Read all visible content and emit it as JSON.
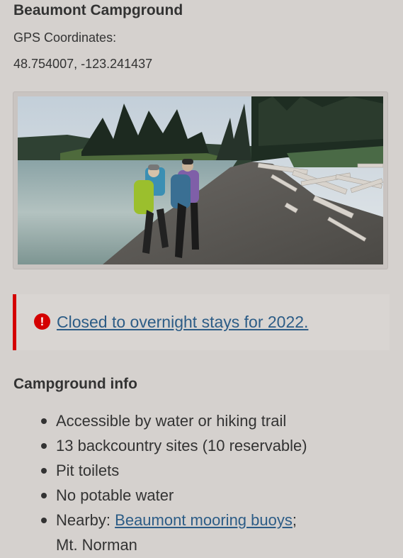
{
  "header": {
    "title": "Beaumont Campground",
    "gps_label": "GPS Coordinates:",
    "gps_value": "48.754007, -123.241437"
  },
  "photo": {
    "subject": "hikers-on-beach-photo"
  },
  "alert": {
    "icon": "exclamation-circle-icon",
    "text": "Closed to overnight stays for 2022.",
    "accent_color": "#d40000",
    "link_color": "#2c5c86"
  },
  "campground_info": {
    "heading": "Campground info",
    "items": [
      "Accessible by water or hiking trail",
      "13 backcountry sites (10 reservable)",
      "Pit toilets",
      "No potable water"
    ],
    "nearby": {
      "prefix": "Nearby: ",
      "link_text": "Beaumont mooring buoys",
      "separator": ";",
      "continuation": "Mt. Norman"
    }
  },
  "colors": {
    "background": "#d5d1ce",
    "text": "#333333"
  }
}
